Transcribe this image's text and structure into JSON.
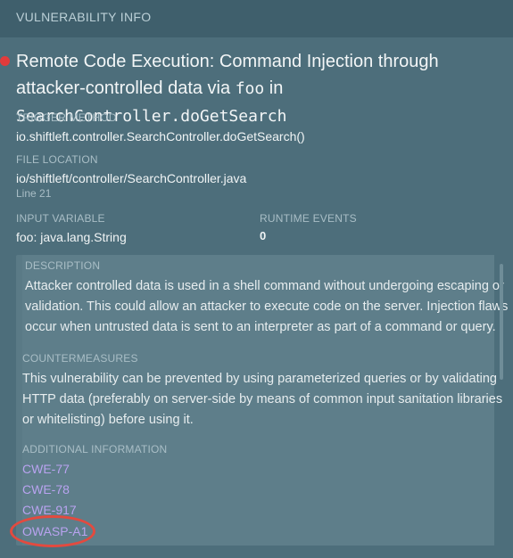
{
  "header": {
    "title": "VULNERABILITY INFO"
  },
  "vulnerability": {
    "title_prefix": "Remote Code Execution: Command Injection through attacker-controlled data via ",
    "title_var": "foo",
    "title_in": " in ",
    "title_method": "SearchController.doGetSearch",
    "severity_color": "#e23b3b"
  },
  "trigger_method": {
    "label": "TRIGGER METHOD",
    "value": "io.shiftleft.controller.SearchController.doGetSearch()"
  },
  "file_location": {
    "label": "FILE LOCATION",
    "value": "io/shiftleft/controller/SearchController.java",
    "line": "Line 21"
  },
  "input_variable": {
    "label": "INPUT VARIABLE",
    "value": "foo: java.lang.String"
  },
  "runtime_events": {
    "label": "RUNTIME EVENTS",
    "value": "0"
  },
  "description": {
    "label": "DESCRIPTION",
    "lines": [
      "Attacker controlled data is used in a shell command without undergoing escaping or",
      "validation. This could allow an attacker to execute code on the server. Injection flaws",
      "occur when untrusted data is sent to an interpreter as part of a command or query."
    ]
  },
  "countermeasures": {
    "label": "COUNTERMEASURES",
    "lines": [
      "This vulnerability can be prevented by using parameterized queries or by validating",
      "HTTP data (preferably on server-side by means of common input sanitation libraries",
      "or whitelisting) before using it."
    ]
  },
  "additional_info": {
    "label": "ADDITIONAL INFORMATION",
    "links": [
      "CWE-77",
      "CWE-78",
      "CWE-917",
      "OWASP-A1"
    ],
    "link_color": "#b9a3f0",
    "highlight_color": "#e34a3f"
  }
}
